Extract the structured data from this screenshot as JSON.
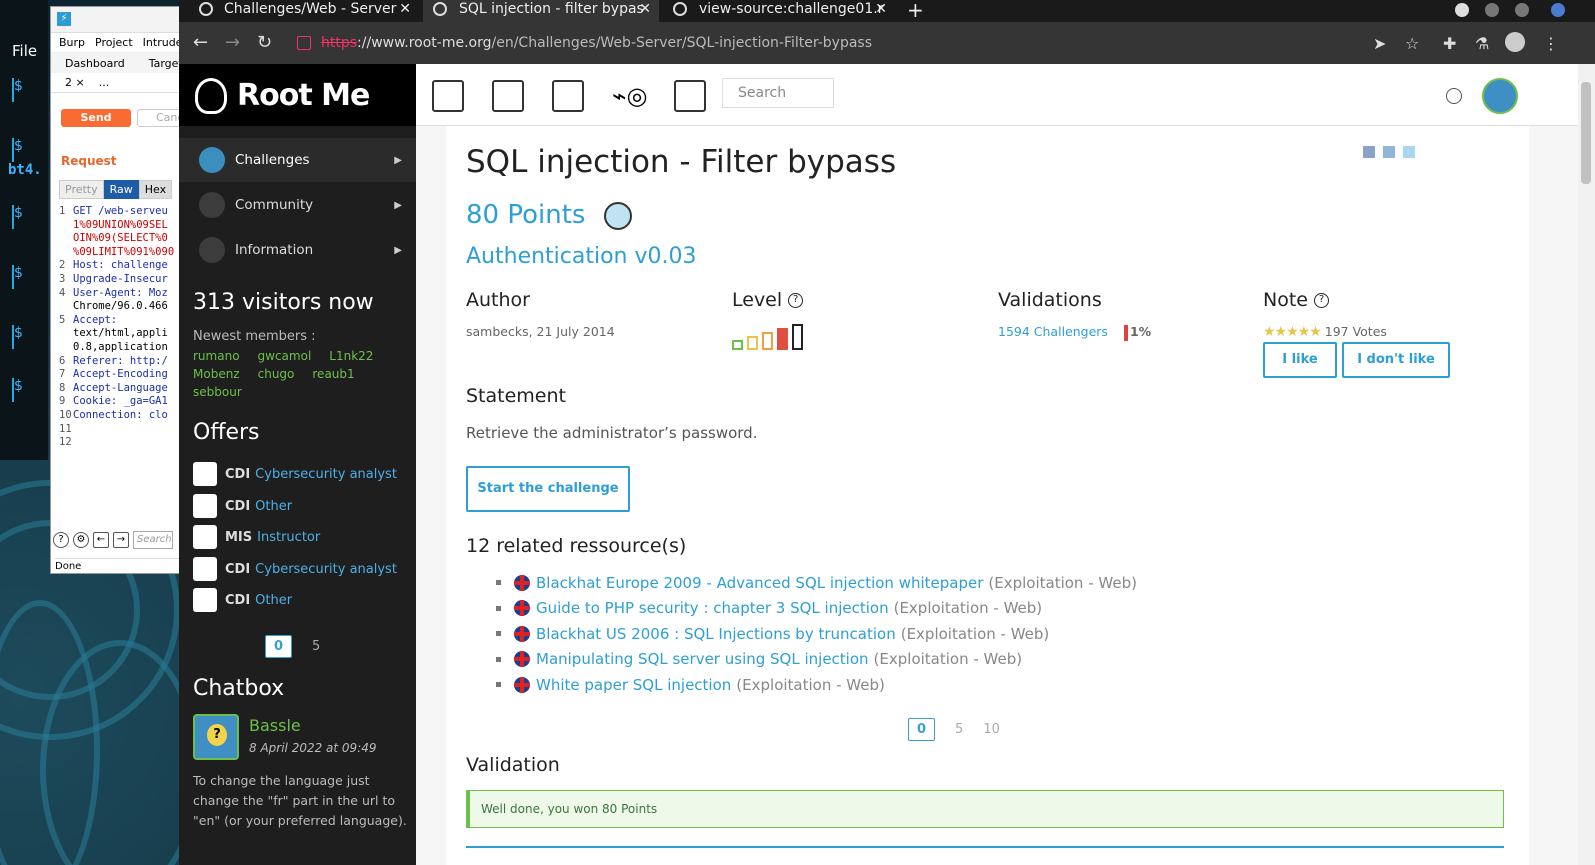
{
  "desktop": {
    "terminal": {
      "file_label": "File",
      "host_fragment": "bt4."
    }
  },
  "burp": {
    "menu": [
      "Burp",
      "Project",
      "Intrude"
    ],
    "subtabs": [
      "Dashboard",
      "Target"
    ],
    "req_tab": {
      "num": "2",
      "close": "×",
      "more": "..."
    },
    "send_label": "Send",
    "cancel_label": "Canc",
    "request_label": "Request",
    "view_tabs": [
      "Pretty",
      "Raw",
      "Hex"
    ],
    "lines": [
      {
        "n": "1",
        "t": "GET /web-serveu",
        "c": "b"
      },
      {
        "n": "",
        "t": "1%09UNION%09SEL",
        "c": "r"
      },
      {
        "n": "",
        "t": "OIN%09(SELECT%0",
        "c": "r"
      },
      {
        "n": "",
        "t": "%09LIMIT%091%090",
        "c": "r"
      },
      {
        "n": "2",
        "t": "Host: challenge",
        "c": "b"
      },
      {
        "n": "3",
        "t": "Upgrade-Insecur",
        "c": "b"
      },
      {
        "n": "4",
        "t": "User-Agent: Moz",
        "c": "b"
      },
      {
        "n": "",
        "t": "Chrome/96.0.466",
        "c": ""
      },
      {
        "n": "5",
        "t": "Accept:",
        "c": "b"
      },
      {
        "n": "",
        "t": "text/html,appli",
        "c": ""
      },
      {
        "n": "",
        "t": "0.8,application",
        "c": ""
      },
      {
        "n": "6",
        "t": "Referer: http:/",
        "c": "b"
      },
      {
        "n": "7",
        "t": "Accept-Encoding",
        "c": "b"
      },
      {
        "n": "8",
        "t": "Accept-Language",
        "c": "b"
      },
      {
        "n": "9",
        "t": "Cookie: _ga=GA1",
        "c": "b"
      },
      {
        "n": "10",
        "t": "Connection: clo",
        "c": "b"
      },
      {
        "n": "11",
        "t": "",
        "c": ""
      },
      {
        "n": "12",
        "t": "",
        "c": ""
      }
    ],
    "search_placeholder": "Search",
    "status": "Done"
  },
  "browser": {
    "tabs": [
      {
        "title": "Challenges/Web - Server",
        "close": "✕"
      },
      {
        "title": "SQL injection - filter bypas",
        "close": "✕"
      },
      {
        "title": "view-source:challenge01.r",
        "close": "✕"
      }
    ],
    "new_tab": "+",
    "url_scheme": "https",
    "url_rest": "://www.root-me.org",
    "url_path": "/en/Challenges/Web-Server/SQL-injection-Filter-bypass"
  },
  "site": {
    "brand": "Root Me",
    "search_placeholder": "Search",
    "menu": [
      {
        "label": "Challenges",
        "active": true
      },
      {
        "label": "Community",
        "active": false
      },
      {
        "label": "Information",
        "active": false
      }
    ],
    "visitors": "313 visitors now",
    "newest_members_label": "Newest members :",
    "members": [
      "rumano",
      "gwcamol",
      "L1nk22",
      "Mobenz",
      "chugo",
      "reaub1",
      "sebbour"
    ],
    "offers_title": "Offers",
    "offers": [
      {
        "type": "CDI",
        "title": "Cybersecurity analyst"
      },
      {
        "type": "CDI",
        "title": "Other"
      },
      {
        "type": "MIS",
        "title": "Instructor"
      },
      {
        "type": "CDI",
        "title": "Cybersecurity analyst"
      },
      {
        "type": "CDI",
        "title": "Other"
      }
    ],
    "offers_pager": [
      "0",
      "5"
    ],
    "chatbox_title": "Chatbox",
    "chat": {
      "user": "Bassle",
      "date": "8 April 2022 at 09:49",
      "message": "To change the language just change the \"fr\" part in the url to \"en\" (or your preferred language)."
    }
  },
  "challenge": {
    "title": "SQL injection - Filter bypass",
    "points": "80 Points",
    "subtitle": "Authentication v0.03",
    "author_label": "Author",
    "author_value": "sambecks,  21 July 2014",
    "level_label": "Level",
    "level_value": 4,
    "level_max": 5,
    "validations_label": "Validations",
    "validations_value": "1594 Challengers",
    "validations_pct": "1%",
    "note_label": "Note",
    "note_stars": "★★★★★",
    "note_votes": "197 Votes",
    "like_label": "I like",
    "dislike_label": "I don't like",
    "statement_title": "Statement",
    "statement_text": "Retrieve the administrator’s password.",
    "start_label": "Start the challenge",
    "resources_title": "12 related ressource(s)",
    "resources": [
      {
        "title": "Blackhat Europe 2009 - Advanced SQL injection whitepaper",
        "category": "(Exploitation - Web)"
      },
      {
        "title": "Guide to PHP security : chapter 3 SQL injection",
        "category": "(Exploitation - Web)"
      },
      {
        "title": "Blackhat US 2006 : SQL Injections by truncation",
        "category": "(Exploitation - Web)"
      },
      {
        "title": "Manipulating SQL server using SQL injection",
        "category": "(Exploitation - Web)"
      },
      {
        "title": "White paper SQL injection",
        "category": "(Exploitation - Web)"
      }
    ],
    "resources_pager": [
      "0",
      "5",
      "10"
    ],
    "validation_title": "Validation",
    "success_message": "Well done, you won 80 Points"
  },
  "colors": {
    "accent_blue": "#2e9fd4",
    "green": "#6cc04a",
    "sidebar_bg": "#1e1e1e",
    "burp_orange": "#f86c34"
  }
}
